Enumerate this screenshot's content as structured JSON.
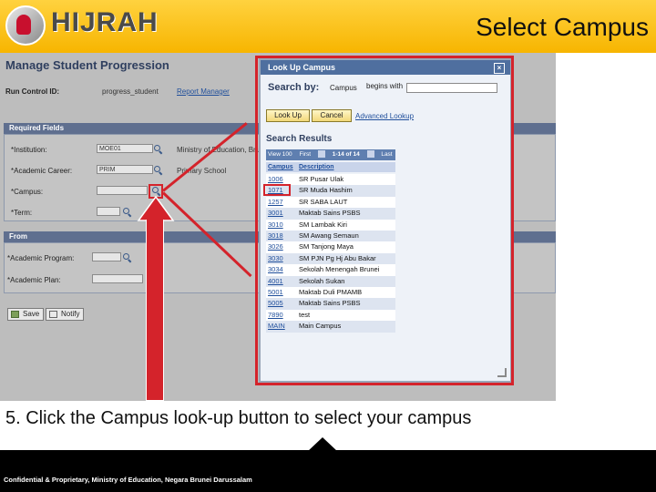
{
  "slide": {
    "title": "Select Campus",
    "instruction": "5. Click the Campus look-up button to select your campus",
    "footer": "Confidential & Proprietary, Ministry of Education, Negara Brunei Darussalam",
    "logo_text": "HIJRAH",
    "accent_color": "#f7b500",
    "annotation_color": "#d4232b"
  },
  "page": {
    "heading": "Manage Student Progression",
    "run_control_label": "Run Control ID:",
    "run_control_value": "progress_student",
    "report_manager_link": "Report Manager",
    "required_fields_label": "Required Fields",
    "fields": {
      "institution_label": "*Institution:",
      "institution_value": "MOE01",
      "institution_desc": "Ministry of Education, Brunei",
      "career_label": "*Academic Career:",
      "career_value": "PRIM",
      "career_desc": "Primary School",
      "campus_label": "*Campus:",
      "term_label": "*Term:"
    },
    "from_label": "From",
    "from_fields": {
      "program_label": "*Academic Program:",
      "plan_label": "*Academic Plan:"
    },
    "save_label": "Save",
    "notify_label": "Notify"
  },
  "lookup": {
    "title": "Look Up Campus",
    "close_label": "×",
    "search_by_label": "Search by:",
    "field_label": "Campus",
    "operator_label": "begins with",
    "lookup_button": "Look Up",
    "cancel_button": "Cancel",
    "advanced_link": "Advanced Lookup",
    "results_heading": "Search Results",
    "nav": {
      "view": "View 100",
      "first": "First",
      "range": "1-14 of 14",
      "last": "Last"
    },
    "columns": [
      "Campus",
      "Description"
    ],
    "rows": [
      {
        "code": "1006",
        "desc": "SR Pusar Ulak"
      },
      {
        "code": "1071",
        "desc": "SR Muda Hashim"
      },
      {
        "code": "1257",
        "desc": "SR SABA LAUT"
      },
      {
        "code": "3001",
        "desc": "Maktab Sains PSBS"
      },
      {
        "code": "3010",
        "desc": "SM Lambak Kiri"
      },
      {
        "code": "3018",
        "desc": "SM Awang Semaun"
      },
      {
        "code": "3026",
        "desc": "SM Tanjong Maya"
      },
      {
        "code": "3030",
        "desc": "SM PJN Pg Hj Abu Bakar"
      },
      {
        "code": "3034",
        "desc": "Sekolah Menengah Brunei"
      },
      {
        "code": "4001",
        "desc": "Sekolah Sukan"
      },
      {
        "code": "5001",
        "desc": "Maktab Duli PMAMB"
      },
      {
        "code": "5005",
        "desc": "Maktab Sains PSBS"
      },
      {
        "code": "7890",
        "desc": "test"
      },
      {
        "code": "MAIN",
        "desc": "Main Campus"
      }
    ]
  }
}
